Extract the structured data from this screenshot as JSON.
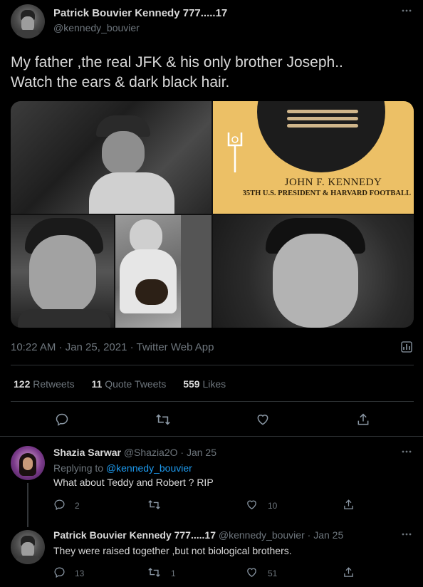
{
  "tweet": {
    "author_name": "Patrick Bouvier Kennedy 777.....17",
    "author_handle": "@kennedy_bouvier",
    "text_line1": "My father ,the real JFK & his only brother Joseph..",
    "text_line2": "Watch the ears & dark black hair.",
    "media_caption_line1": "JOHN F. KENNEDY",
    "media_caption_line2": "35TH U.S. PRESIDENT & HARVARD FOOTBALL",
    "meta": "10:22 AM · Jan 25, 2021 · Twitter Web App",
    "stats": {
      "retweets_count": "122",
      "retweets_label": "Retweets",
      "quotes_count": "11",
      "quotes_label": "Quote Tweets",
      "likes_count": "559",
      "likes_label": "Likes"
    }
  },
  "replies": [
    {
      "name": "Shazia Sarwar",
      "handle": "@Shazia2O",
      "date": "· Jan 25",
      "replying_prefix": "Replying to",
      "replying_to": "@kennedy_bouvier",
      "text": "What about Teddy and Robert ? RIP",
      "reply_count": "2",
      "retweet_count": "",
      "like_count": "10"
    },
    {
      "name": "Patrick Bouvier Kennedy 777.....17",
      "handle": "@kennedy_bouvier",
      "date": "· Jan 25",
      "text": "They were raised together ,but not biological brothers.",
      "reply_count": "13",
      "retweet_count": "1",
      "like_count": "51"
    }
  ],
  "icons": {
    "more": "more-icon",
    "reply": "reply-icon",
    "retweet": "retweet-icon",
    "like": "heart-icon",
    "share": "share-icon",
    "analytics": "analytics-icon"
  },
  "colors": {
    "background": "#000000",
    "text": "#d9d9d9",
    "muted": "#6e767d",
    "link": "#1d9bf0",
    "divider": "#2f3336"
  }
}
